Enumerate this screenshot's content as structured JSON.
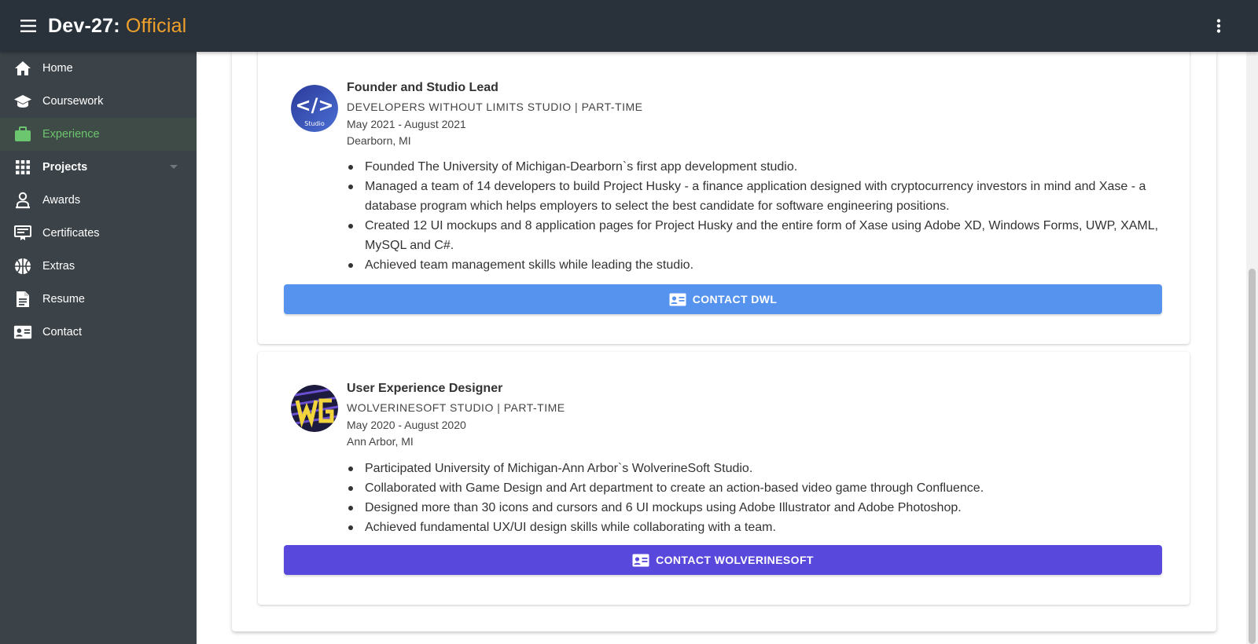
{
  "app": {
    "title_main": "Dev-27: ",
    "title_accent": "Official",
    "accent_color": "#f0a12c",
    "menu_icon": "hamburger-menu-icon",
    "more_icon": "more-vertical-icon"
  },
  "sidebar": {
    "items": [
      {
        "label": "Home",
        "icon": "home-icon"
      },
      {
        "label": "Coursework",
        "icon": "graduation-cap-icon"
      },
      {
        "label": "Experience",
        "icon": "briefcase-icon",
        "active": true
      },
      {
        "label": "Projects",
        "icon": "grid-icon",
        "expandable": true
      },
      {
        "label": "Awards",
        "icon": "award-person-icon"
      },
      {
        "label": "Certificates",
        "icon": "certificate-icon"
      },
      {
        "label": "Extras",
        "icon": "basketball-icon"
      },
      {
        "label": "Resume",
        "icon": "document-icon"
      },
      {
        "label": "Contact",
        "icon": "contact-card-icon"
      }
    ],
    "active_color": "#6cc56f"
  },
  "experiences": [
    {
      "role": "Founder and Studio Lead",
      "company": "DEVELOPERS WITHOUT LIMITS STUDIO | PART-TIME",
      "dates": "May 2021 - August 2021",
      "location": "Dearborn, MI",
      "logo_text": "</>",
      "logo_subtext": "Studio",
      "bullets": [
        "Founded The University of Michigan-Dearborn`s first app development studio.",
        "Managed a team of 14 developers to build Project Husky - a finance application designed with cryptocurrency investors in mind and Xase - a database program which helps employers to select the best candidate for software engineering positions.",
        "Created 12 UI mockups and 8 application pages for Project Husky and the entire form of Xase using Adobe XD, Windows Forms, UWP, XAML, MySQL and C#.",
        "Achieved team management skills while leading the studio."
      ],
      "button_label": "CONTACT DWL",
      "button_color": "#5693ee"
    },
    {
      "role": "User Experience Designer",
      "company": "WOLVERINESOFT STUDIO | PART-TIME",
      "dates": "May 2020 - August 2020",
      "location": "Ann Arbor, MI",
      "bullets": [
        "Participated University of Michigan-Ann Arbor`s WolverineSoft Studio.",
        "Collaborated with Game Design and Art department to create an action-based video game through Confluence.",
        "Designed more than 30 icons and cursors and 6 UI mockups using Adobe Illustrator and Adobe Photoshop.",
        "Achieved fundamental UX/UI design skills while collaborating with a team."
      ],
      "button_label": "CONTACT WOLVERINESOFT",
      "button_color": "#5848db"
    }
  ]
}
